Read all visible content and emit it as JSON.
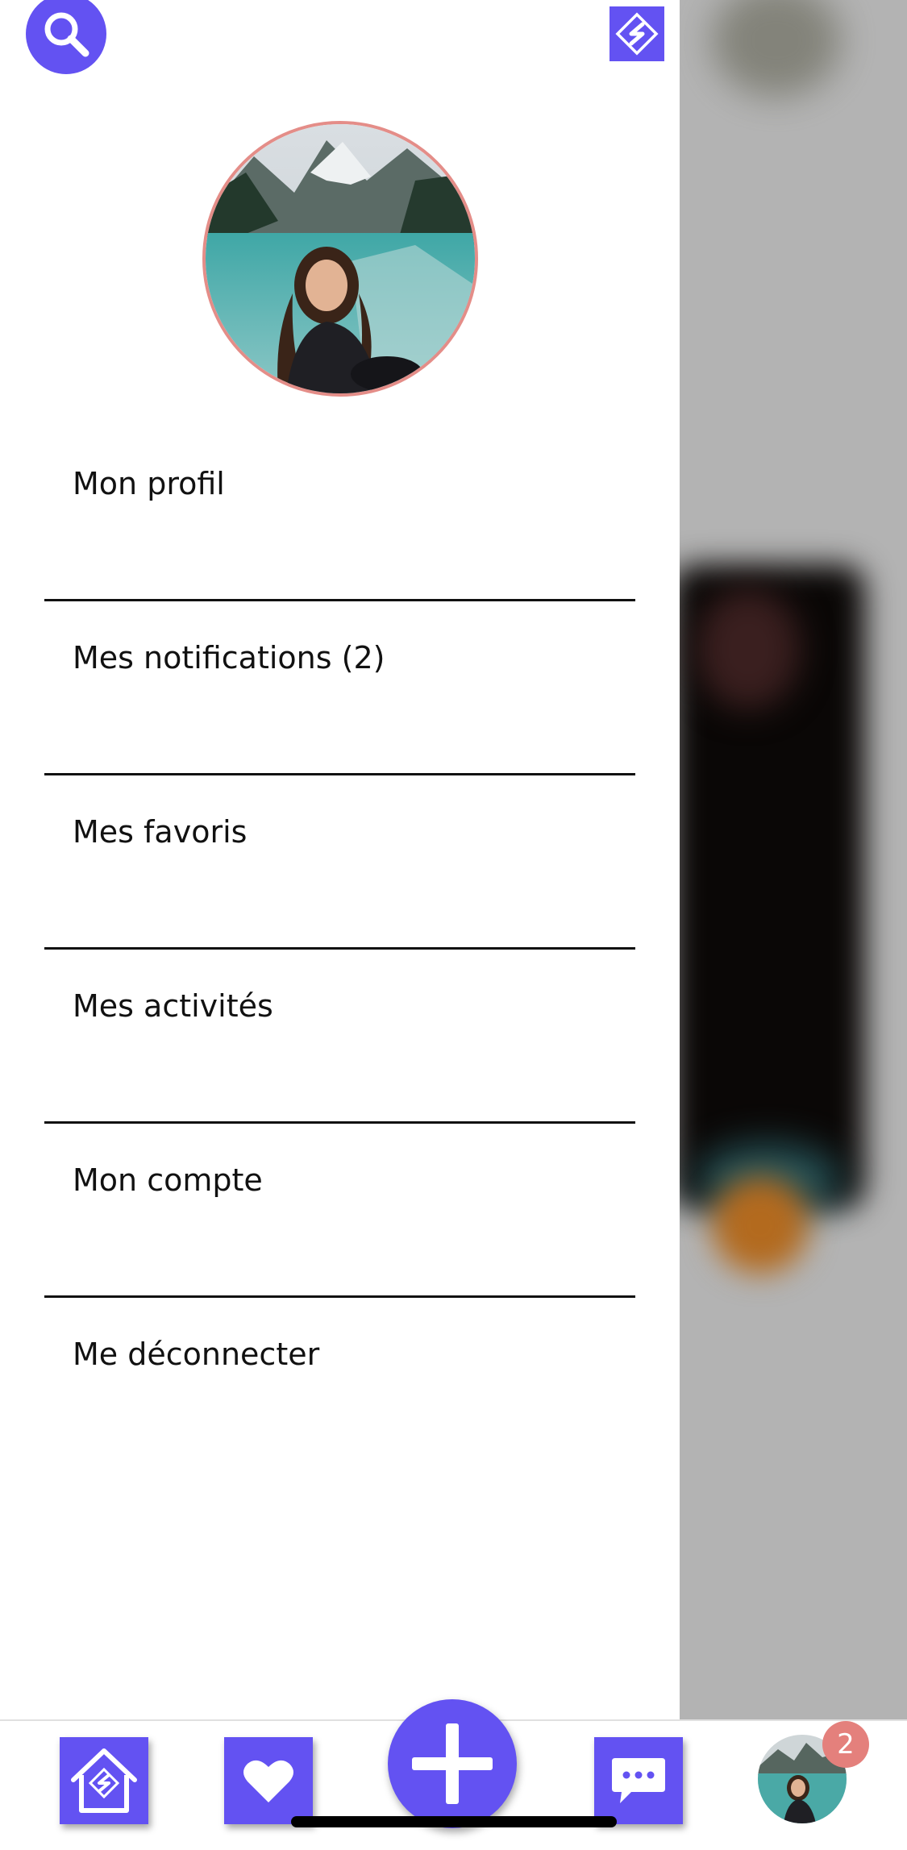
{
  "drawer": {
    "menu": [
      {
        "label": "Mon profil"
      },
      {
        "label": "Mes notifications (2)"
      },
      {
        "label": "Mes favoris"
      },
      {
        "label": "Mes activités"
      },
      {
        "label": "Mon compte"
      },
      {
        "label": "Me déconnecter"
      }
    ]
  },
  "tabbar": {
    "icons": [
      "home-icon",
      "heart-icon",
      "plus-icon",
      "chat-icon",
      "avatar"
    ],
    "notification_count": "2"
  },
  "colors": {
    "accent": "#6352f2",
    "avatar_border": "#e48d88",
    "badge": "#e4807c"
  }
}
